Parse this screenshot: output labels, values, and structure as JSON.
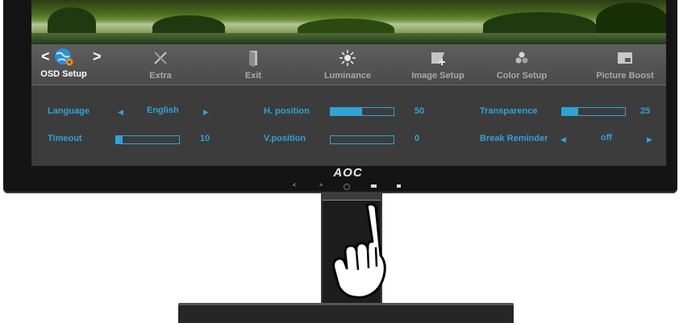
{
  "brand": {
    "logo": "AOC"
  },
  "front_buttons": {
    "left": "<",
    "right": ">",
    "enter_icon": "enter-icon",
    "menu_icon": "menu-icon",
    "power_icon": "power-icon"
  },
  "menu": {
    "tabs": [
      {
        "label": "OSD Setup",
        "icon": "globe-gear-icon",
        "active": true
      },
      {
        "label": "Extra",
        "icon": "tools-icon"
      },
      {
        "label": "Exit",
        "icon": "door-icon"
      },
      {
        "label": "Luminance",
        "icon": "sun-icon"
      },
      {
        "label": "Image Setup",
        "icon": "image-setup-icon"
      },
      {
        "label": "Color Setup",
        "icon": "color-dots-icon"
      },
      {
        "label": "Picture Boost",
        "icon": "picture-boost-icon"
      }
    ],
    "nav_left": "<",
    "nav_right": ">"
  },
  "settings": {
    "language": {
      "label": "Language",
      "value": "English"
    },
    "timeout": {
      "label": "Timeout",
      "value": "10",
      "level": 10
    },
    "h_position": {
      "label": "H. position",
      "value": "50",
      "level": 50
    },
    "v_position": {
      "label": "V.position",
      "value": "0",
      "level": 0
    },
    "transparence": {
      "label": "Transparence",
      "value": "25",
      "level": 25
    },
    "break_reminder": {
      "label": "Break Reminder",
      "value": "off"
    }
  },
  "colors": {
    "accent": "#2fa3d6",
    "menu_bg": "#4a4a4a",
    "panel_bg": "#3c3c3c"
  }
}
